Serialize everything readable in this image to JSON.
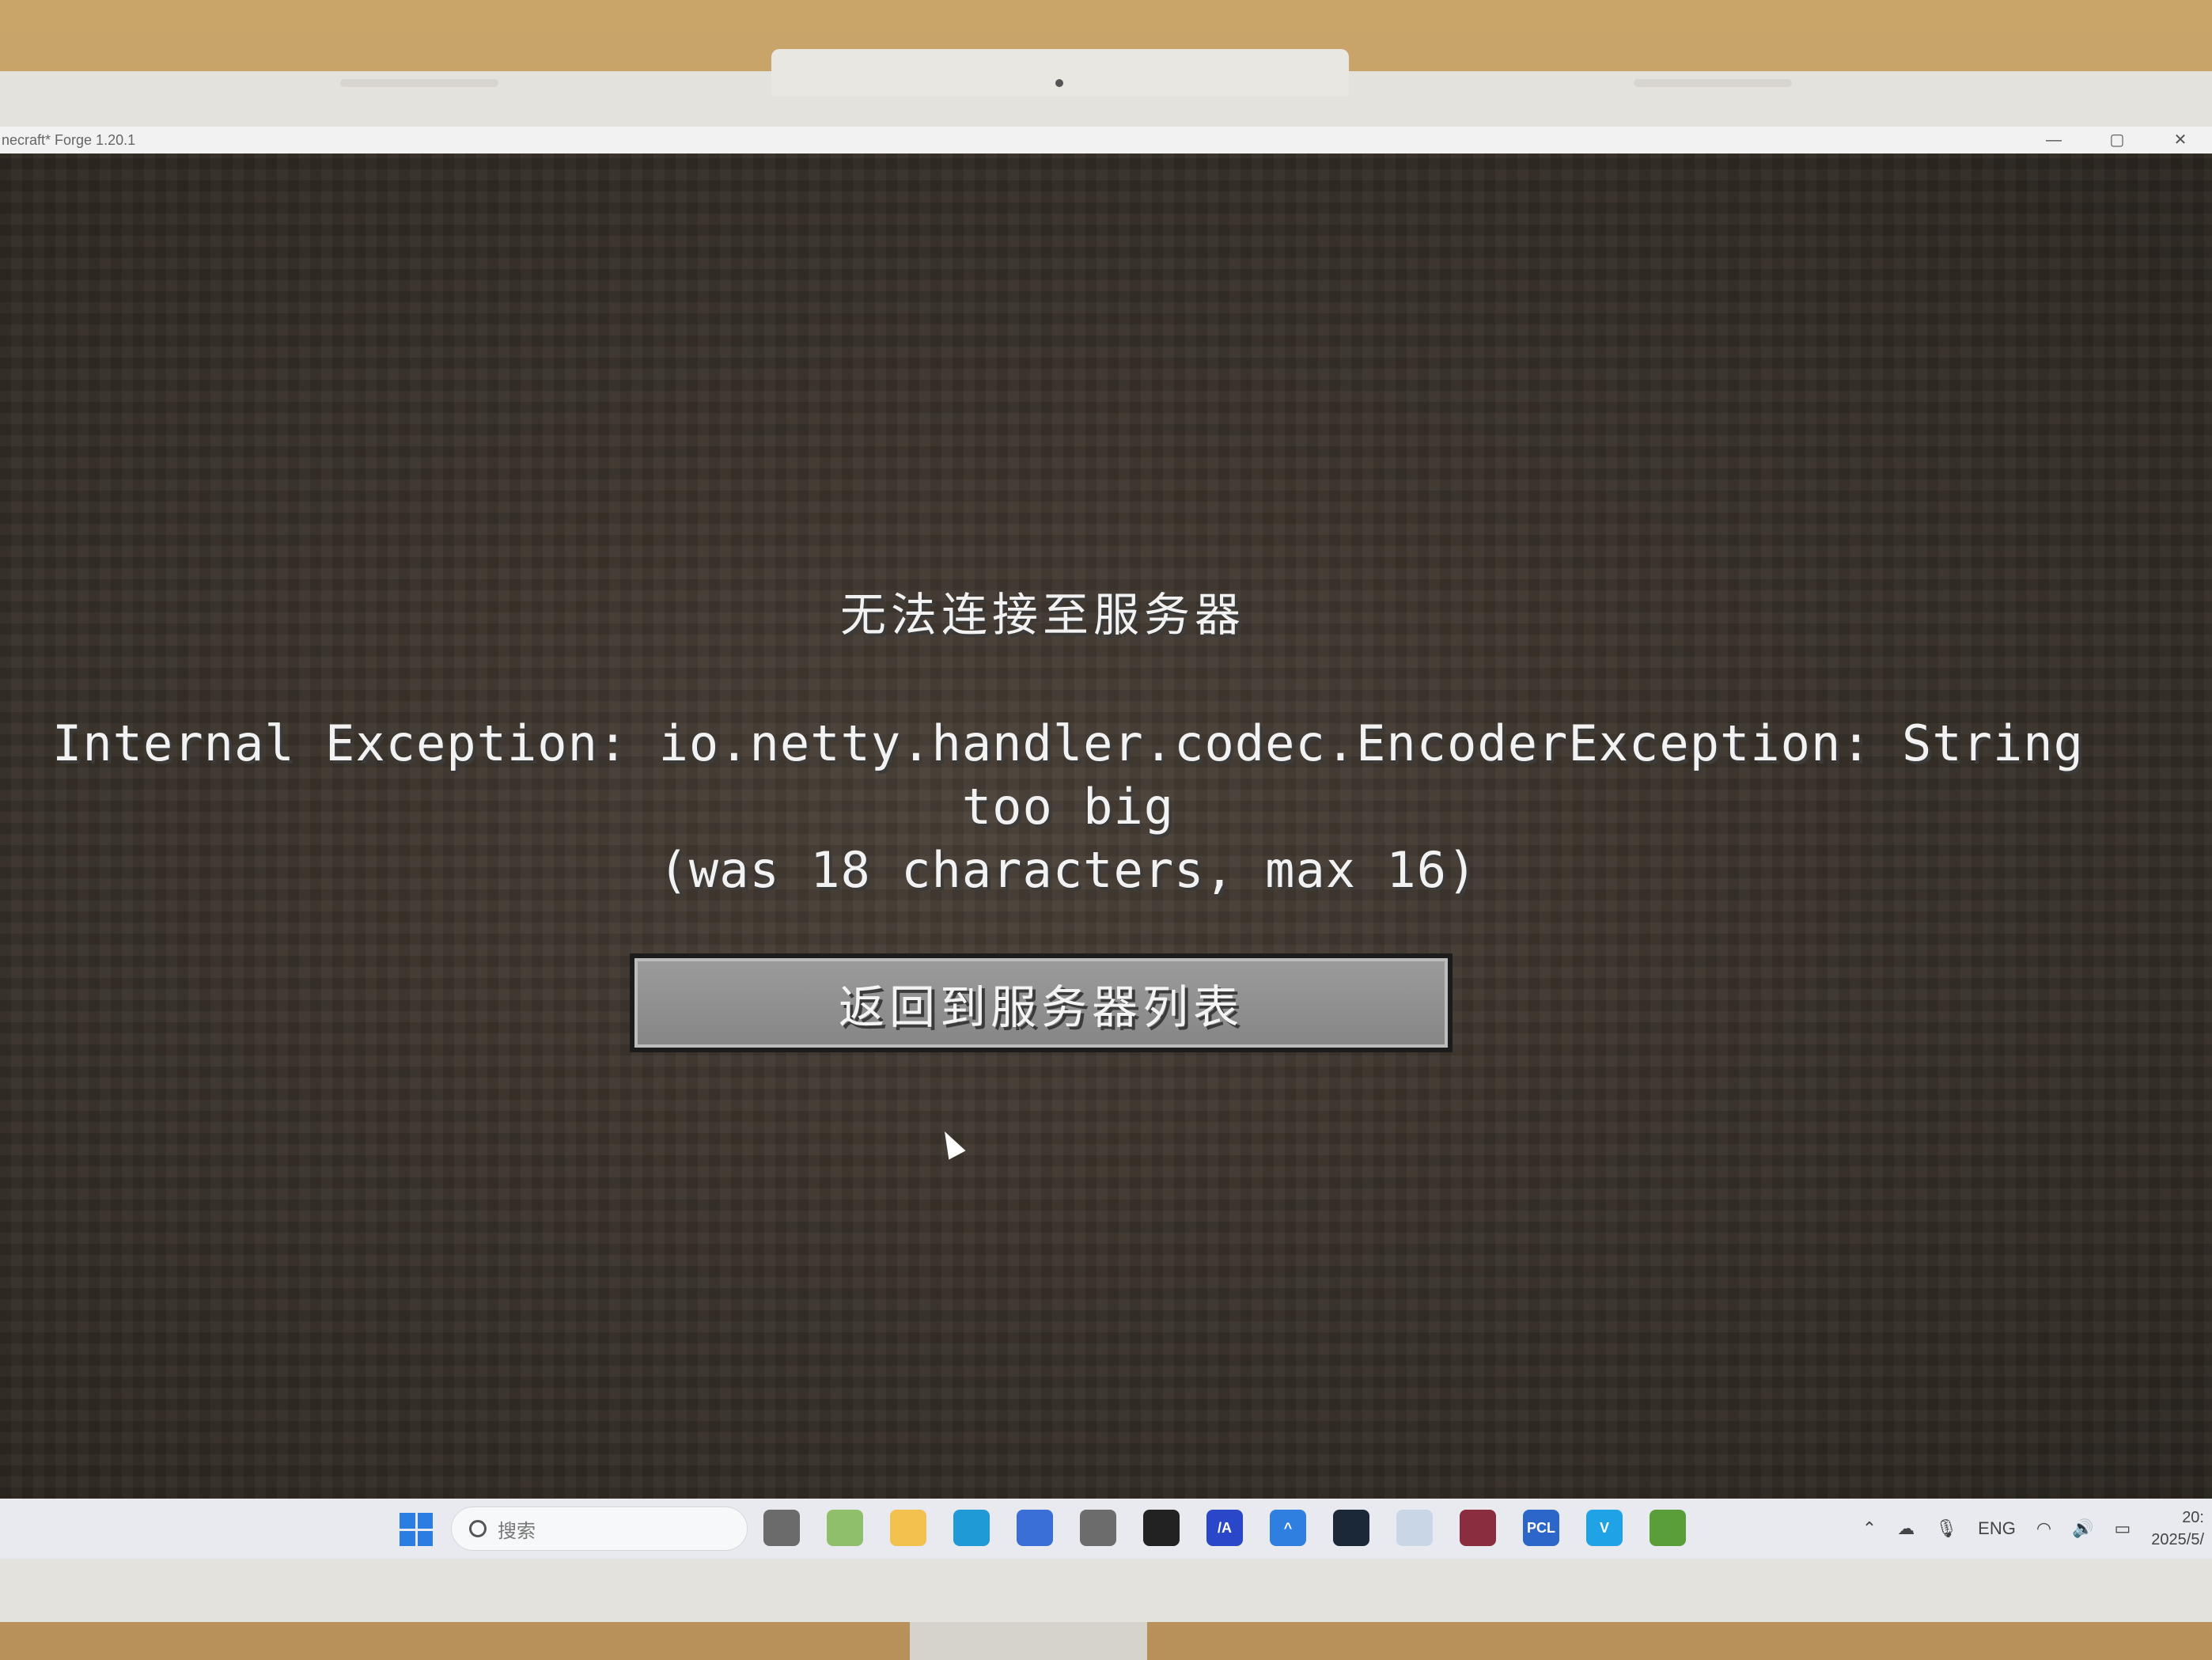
{
  "window": {
    "title": "necraft* Forge 1.20.1",
    "controls": {
      "minimize": "—",
      "restore": "▢",
      "close": "✕"
    }
  },
  "screen": {
    "heading": "无法连接至服务器",
    "error_line1": "Internal Exception: io.netty.handler.codec.EncoderException: String too big",
    "error_line2": "(was 18 characters, max 16)",
    "back_button": "返回到服务器列表"
  },
  "taskbar": {
    "search_placeholder": "搜索",
    "apps": [
      {
        "name": "task-view-icon",
        "label": "",
        "color": "#6b6b6b"
      },
      {
        "name": "paint-icon",
        "label": "",
        "color": "#8fbf6a"
      },
      {
        "name": "file-explorer-icon",
        "label": "",
        "color": "#f2c14e"
      },
      {
        "name": "edge-icon",
        "label": "",
        "color": "#1f9ad6"
      },
      {
        "name": "store-icon",
        "label": "",
        "color": "#3b6fd8"
      },
      {
        "name": "cube-app-icon",
        "label": "",
        "color": "#6c6c6c"
      },
      {
        "name": "qq-icon",
        "label": "",
        "color": "#222222"
      },
      {
        "name": "app-ia-icon",
        "label": "/A",
        "color": "#2b47c9"
      },
      {
        "name": "app-arrow-icon",
        "label": "^",
        "color": "#2f7fe0"
      },
      {
        "name": "steam-icon",
        "label": "",
        "color": "#1b2838"
      },
      {
        "name": "snip-tool-icon",
        "label": "",
        "color": "#c9d6e6"
      },
      {
        "name": "winrar-icon",
        "label": "",
        "color": "#8a2d3e"
      },
      {
        "name": "pcl-icon",
        "label": "PCL",
        "color": "#2d66c9"
      },
      {
        "name": "v-app-icon",
        "label": "V",
        "color": "#1fa3e6"
      },
      {
        "name": "minecraft-icon",
        "label": "",
        "color": "#5a9e3a"
      }
    ],
    "tray": {
      "language": "ENG",
      "time": "20:",
      "date": "2025/5/"
    }
  }
}
